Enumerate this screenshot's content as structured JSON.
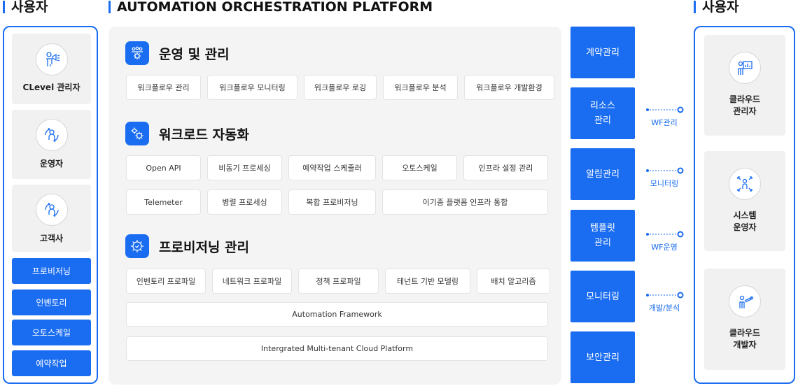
{
  "headers": {
    "left_users": "사용자",
    "platform": "AUTOMATION ORCHESTRATION PLATFORM",
    "right_users": "사용자"
  },
  "left_users": [
    {
      "label": "CLevel 관리자",
      "icon": "presenter-megaphone-icon"
    },
    {
      "label": "운영자",
      "icon": "person-cycle-icon"
    },
    {
      "label": "고객사",
      "icon": "person-cycle-icon"
    }
  ],
  "left_buttons": [
    "프로비저닝",
    "인벤토리",
    "오토스케일",
    "예약작업"
  ],
  "sections": [
    {
      "title": "운영 및 관리",
      "icon": "group-gear-icon"
    },
    {
      "title": "워크로드 자동화",
      "icon": "gears-icon"
    },
    {
      "title": "프로비저닝 관리",
      "icon": "gear-check-icon"
    }
  ],
  "ops_chips": [
    "워크플로우 관리",
    "워크플로우 모니터링",
    "워크플로우 로깅",
    "워크플로우 분석",
    "워크플로우 개발환경"
  ],
  "workload_row1": [
    "Open API",
    "비동기 프로세싱",
    "예약작업 스케줄러",
    "오토스케일",
    "인프라 설정 관리"
  ],
  "workload_row2": [
    "Telemeter",
    "병렬 프로세싱",
    "복합 프로비저닝",
    "이기종 플랫폼 인프라 통합"
  ],
  "prov_chips": [
    "인벤토리 프로파일",
    "네트워크 프로파일",
    "정책 프로파일",
    "테넌트 기반 모델링",
    "배치 알고리즘"
  ],
  "framework": "Automation Framework",
  "cloud_platform": "Intergrated Multi-tenant Cloud Platform",
  "mgmt_blocks": [
    "계약관리",
    "리소스\n관리",
    "알림관리",
    "템플릿\n관리",
    "모니터링",
    "보안관리"
  ],
  "connectors": [
    "WF관리",
    "모니터링",
    "WF운영",
    "개발/분석"
  ],
  "right_users": [
    {
      "label": "클라우드\n관리자",
      "icon": "person-dashboard-icon"
    },
    {
      "label": "시스템\n운영자",
      "icon": "person-arrows-icon"
    },
    {
      "label": "클라우드\n개발자",
      "icon": "person-telescope-icon"
    }
  ],
  "colors": {
    "accent": "#1a6cf0",
    "panel": "#f4f4f4",
    "card": "#f1f1f1"
  }
}
